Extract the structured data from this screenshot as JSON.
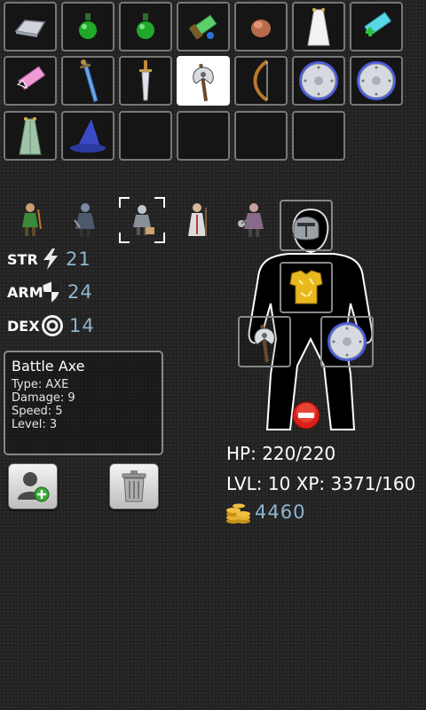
{
  "inventory": {
    "row1": [
      "steel-ingot",
      "green-potion",
      "green-potion",
      "green-scroll",
      "ore-chunk",
      "white-robe",
      "cyan-scroll"
    ],
    "row2": [
      "pink-scroll",
      "blue-sword",
      "short-sword",
      "battle-axe",
      "longbow",
      "round-shield",
      "round-shield"
    ],
    "row3": [
      "green-robe",
      "wizard-hat"
    ],
    "selected_item": "battle-axe"
  },
  "party": {
    "heroes": [
      "ranger-hero",
      "rogue-hero",
      "knight-hero",
      "priest-hero",
      "berserker-hero"
    ],
    "selected_hero": "knight-hero"
  },
  "stats": {
    "str_label": "STR",
    "str_value": "21",
    "arm_label": "ARM",
    "arm_value": "24",
    "dex_label": "DEX",
    "dex_value": "14"
  },
  "item_details": {
    "name": "Battle Axe",
    "type": "Type: AXE",
    "damage": "Damage: 9",
    "speed": "Speed: 5",
    "level": "Level: 3"
  },
  "equipment": {
    "head": "steel-helmet",
    "chest": "gold-armor",
    "main_hand": "battle-axe",
    "off_hand": "round-shield"
  },
  "character": {
    "hp": "HP: 220/220",
    "level_xp": "LVL: 10 XP: 3371/160",
    "gold": "4460"
  },
  "colors": {
    "stat_value": "#8fb6cf",
    "slot_border": "#777777",
    "background": "#222222"
  }
}
